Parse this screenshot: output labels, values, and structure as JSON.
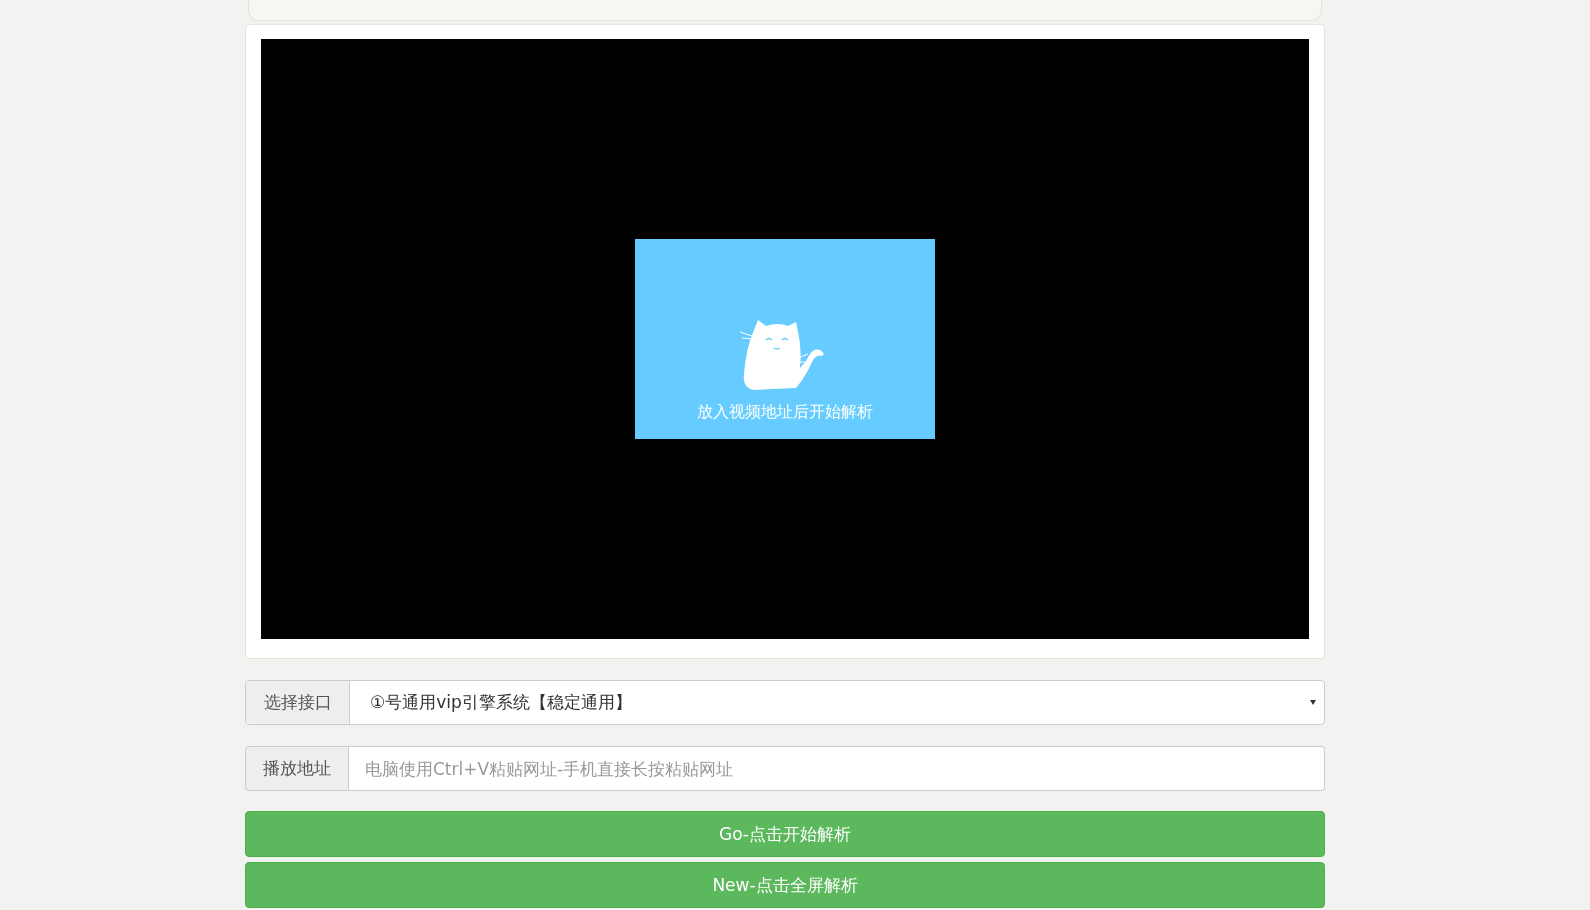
{
  "player": {
    "message": "放入视频地址后开始解析"
  },
  "interface_select": {
    "label": "选择接口",
    "value": "①号通用vip引擎系统【稳定通用】"
  },
  "url_field": {
    "label": "播放地址",
    "placeholder": "电脑使用Ctrl+V粘贴网址-手机直接长按粘贴网址"
  },
  "buttons": [
    {
      "label": "Go-点击开始解析"
    },
    {
      "label": "New-点击全屏解析"
    }
  ]
}
